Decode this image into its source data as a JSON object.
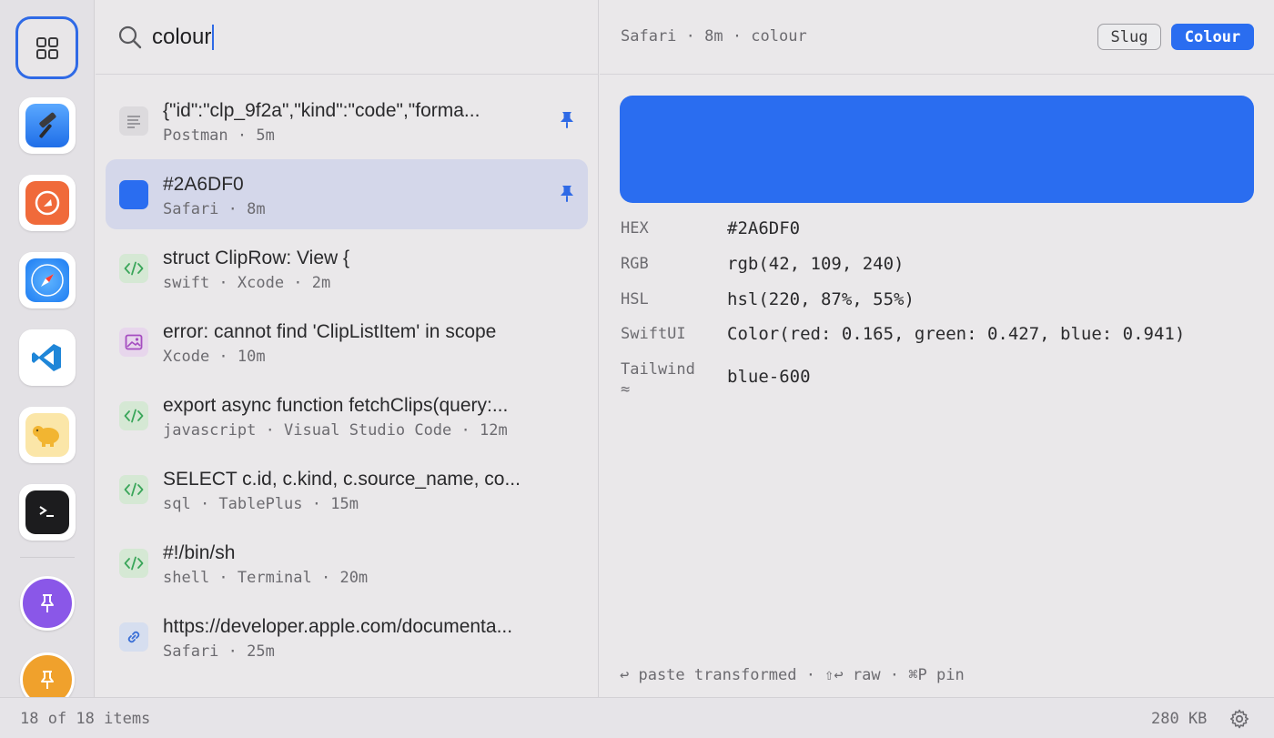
{
  "search": {
    "query": "colour"
  },
  "list": {
    "items": [
      {
        "title": "{\"id\":\"clp_9f2a\",\"kind\":\"code\",\"forma...",
        "meta": "Postman · 5m",
        "icon": "text-icon",
        "pinned": true
      },
      {
        "title": "#2A6DF0",
        "meta": "Safari · 8m",
        "icon": "color-swatch-icon",
        "pinned": true,
        "selected": true
      },
      {
        "title": "struct ClipRow: View {",
        "meta": "swift · Xcode · 2m",
        "icon": "code-icon"
      },
      {
        "title": "error: cannot find 'ClipListItem' in scope",
        "meta": "Xcode · 10m",
        "icon": "image-icon"
      },
      {
        "title": "export async function fetchClips(query:...",
        "meta": "javascript · Visual Studio Code · 12m",
        "icon": "code-icon"
      },
      {
        "title": "SELECT c.id, c.kind, c.source_name, co...",
        "meta": "sql · TablePlus · 15m",
        "icon": "code-icon"
      },
      {
        "title": "#!/bin/sh",
        "meta": "shell · Terminal · 20m",
        "icon": "code-icon"
      },
      {
        "title": "https://developer.apple.com/documenta...",
        "meta": "Safari · 25m",
        "icon": "link-icon"
      }
    ]
  },
  "detail": {
    "header_meta": "Safari · 8m · colour",
    "slug_label": "Slug",
    "colour_label": "Colour",
    "swatch_color": "#2A6DF0",
    "props": [
      {
        "label": "HEX",
        "value": "#2A6DF0"
      },
      {
        "label": "RGB",
        "value": "rgb(42, 109, 240)"
      },
      {
        "label": "HSL",
        "value": "hsl(220, 87%, 55%)"
      },
      {
        "label": "SwiftUI",
        "value": "Color(red: 0.165, green: 0.427, blue: 0.941)"
      },
      {
        "label": "Tailwind ≈",
        "value": "blue-600"
      }
    ],
    "hints": "↩ paste transformed · ⇧↩ raw · ⌘P pin"
  },
  "footer": {
    "count": "18 of 18 items",
    "size": "280 KB"
  },
  "colors": {
    "accent": "#2A6DF0",
    "pin": "#2f6ae6",
    "selected_row": "#d4d7ea"
  }
}
